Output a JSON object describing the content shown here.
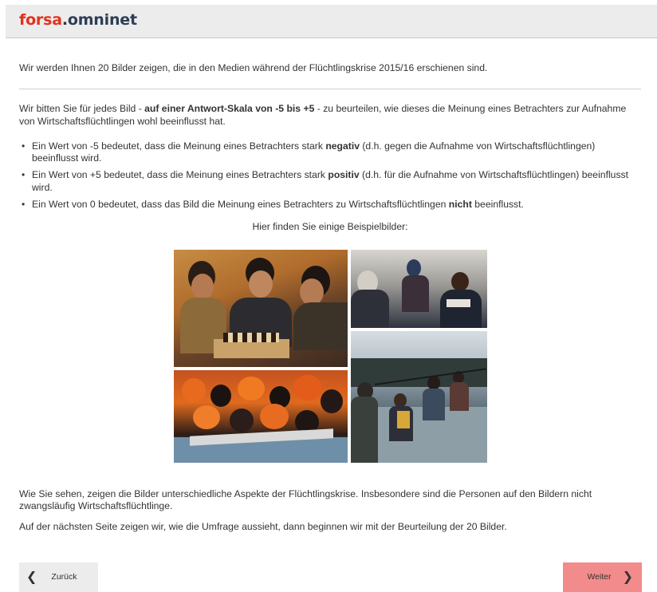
{
  "header": {
    "logo_part1": "forsa",
    "logo_dot": ".",
    "logo_part2": "omninet"
  },
  "intro": "Wir werden Ihnen 20 Bilder zeigen, die in den Medien während der Flüchtlingskrise 2015/16 erschienen sind.",
  "scale_paragraph": {
    "before": "Wir bitten Sie für jedes Bild - ",
    "bold": "auf einer Antwort-Skala von -5 bis +5",
    "after": " - zu beurteilen, wie dieses die Meinung eines Betrachters zur Aufnahme von Wirtschaftsflüchtlingen wohl beeinflusst hat."
  },
  "bullets": [
    {
      "before": "Ein Wert von -5 bedeutet, dass die Meinung eines Betrachters stark ",
      "bold": "negativ",
      "after": " (d.h. gegen die Aufnahme von Wirtschaftsflüchtlingen) beeinflusst wird."
    },
    {
      "before": "Ein Wert von +5 bedeutet, dass die Meinung eines Betrachters stark ",
      "bold": "positiv",
      "after": " (d.h. für die Aufnahme von Wirtschaftsflüchtlingen) beeinflusst wird."
    },
    {
      "before": "Ein Wert von 0 bedeutet, dass das Bild die Meinung eines Betrachters zu Wirtschaftsflüchtlingen ",
      "bold": "nicht",
      "after": " beeinflusst."
    }
  ],
  "example_label": "Hier finden Sie einige Beispielbilder:",
  "footer": {
    "aspects": "Wie Sie sehen, zeigen die Bilder unterschiedliche Aspekte der Flüchtlingskrise. Insbesondere sind die Personen auf den Bildern nicht zwangsläufig Wirtschaftsflüchtlinge.",
    "next_page": "Auf der nächsten Seite zeigen wir, wie die Umfrage aussieht, dann beginnen wir mit der Beurteilung der 20 Bilder."
  },
  "nav": {
    "back_label": "Zurück",
    "next_label": "Weiter",
    "back_icon": "chevron-left-icon",
    "next_icon": "chevron-right-icon"
  },
  "colors": {
    "brand_red": "#e0321e",
    "brand_navy": "#2c3e55",
    "next_button": "#f28b8b",
    "header_bg": "#ececec"
  }
}
